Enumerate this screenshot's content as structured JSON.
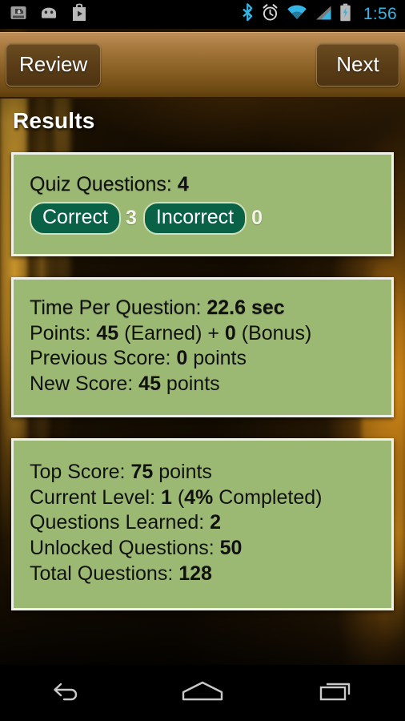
{
  "statusbar": {
    "clock": "1:56",
    "left_icons": [
      "sdcard-icon",
      "android-robot-icon",
      "play-store-icon"
    ],
    "right_icons": [
      "bluetooth-icon",
      "alarm-clock-icon",
      "wifi-icon",
      "cell-signal-icon",
      "battery-charging-icon"
    ],
    "accent_color": "#33b5e5"
  },
  "actionbar": {
    "review_label": "Review",
    "next_label": "Next"
  },
  "page": {
    "title": "Results",
    "card_color": "#9cb974",
    "card_border_color": "#f0f0ea",
    "pill_color": "#0a6246"
  },
  "cards": [
    {
      "name": "quiz-summary-card",
      "line": {
        "label": "Quiz Questions:",
        "value": "4"
      },
      "badges": [
        {
          "label": "Correct",
          "value": "3"
        },
        {
          "label": "Incorrect",
          "value": "0"
        }
      ]
    },
    {
      "name": "score-card",
      "lines": [
        {
          "pre": "Time Per Question: ",
          "bold": "22.6 sec",
          "post": "",
          "white": true
        },
        {
          "pre": "Points: ",
          "bold": "45",
          "post": " (Earned) + ",
          "bold2": "0",
          "post2": " (Bonus)",
          "white": false
        },
        {
          "pre": "Previous Score: ",
          "bold": "0",
          "post": " points",
          "white": false
        },
        {
          "pre": "New Score: ",
          "bold": "45",
          "post": " points",
          "white": false
        }
      ]
    },
    {
      "name": "progress-card",
      "lines": [
        {
          "pre": "Top Score: ",
          "bold": "75",
          "post": " points"
        },
        {
          "pre": "Current Level: ",
          "bold": "1",
          "post": " (",
          "bold2": "4%",
          "post2": " Completed)"
        },
        {
          "pre": "Questions Learned: ",
          "bold": "2",
          "post": ""
        },
        {
          "pre": "Unlocked Questions: ",
          "bold": "50",
          "post": ""
        },
        {
          "pre": "Total Questions: ",
          "bold": "128",
          "post": ""
        }
      ]
    }
  ],
  "navbar": {
    "back_label": "back-icon",
    "home_label": "home-icon",
    "recents_label": "recents-icon"
  }
}
